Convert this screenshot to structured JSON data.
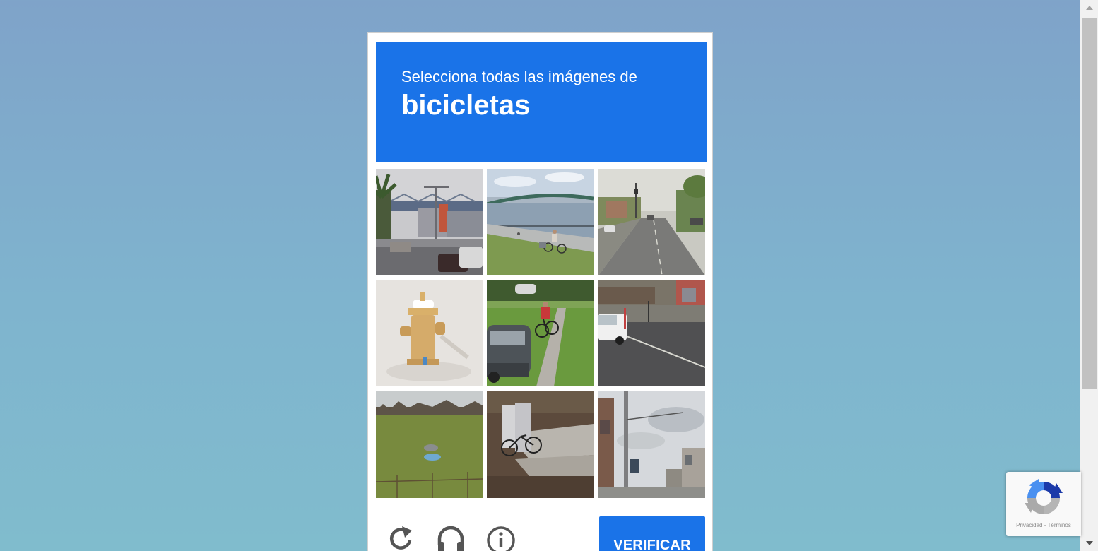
{
  "challenge": {
    "instruction": "Selecciona todas las imágenes de",
    "target_word": "bicicletas",
    "accent_color": "#1a73e8",
    "tiles": [
      {
        "scene": "city-street-with-bridge"
      },
      {
        "scene": "cyclist-on-waterfront-path"
      },
      {
        "scene": "town-road-with-cars"
      },
      {
        "scene": "fire-hydrant"
      },
      {
        "scene": "cyclist-on-sidewalk-by-park"
      },
      {
        "scene": "pickup-truck-at-intersection"
      },
      {
        "scene": "grass-field"
      },
      {
        "scene": "bicycle-parked-by-utility-box"
      },
      {
        "scene": "street-pole-and-storefronts"
      }
    ],
    "footer": {
      "reload_icon": "reload-icon",
      "audio_icon": "headphones-icon",
      "info_icon": "info-icon",
      "verify_label": "VERIFICAR"
    }
  },
  "badge": {
    "logo_icon": "recaptcha-logo",
    "privacy_label": "Privacidad",
    "separator": " - ",
    "terms_label": "Términos"
  }
}
